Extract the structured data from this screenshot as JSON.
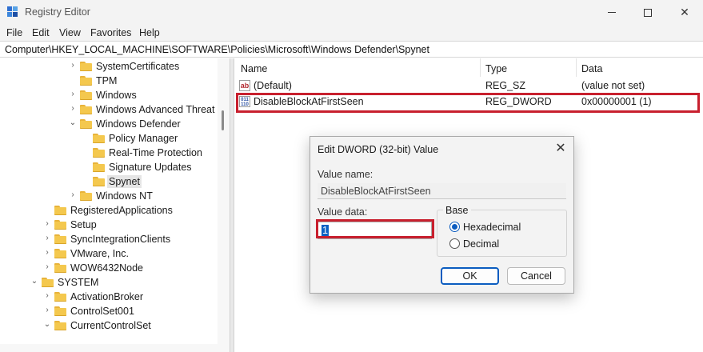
{
  "window": {
    "title": "Registry Editor"
  },
  "menu": [
    "File",
    "Edit",
    "View",
    "Favorites",
    "Help"
  ],
  "address": "Computer\\HKEY_LOCAL_MACHINE\\SOFTWARE\\Policies\\Microsoft\\Windows Defender\\Spynet",
  "tree": [
    {
      "label": "SystemCertificates",
      "chevron": ">"
    },
    {
      "label": "TPM",
      "chevron": ""
    },
    {
      "label": "Windows",
      "chevron": ">"
    },
    {
      "label": "Windows Advanced Threat P",
      "chevron": ">"
    },
    {
      "label": "Windows Defender",
      "chevron": "v"
    },
    {
      "label": "Policy Manager",
      "chevron": ""
    },
    {
      "label": "Real-Time Protection",
      "chevron": ""
    },
    {
      "label": "Signature Updates",
      "chevron": ""
    },
    {
      "label": "Spynet",
      "chevron": ""
    },
    {
      "label": "Windows NT",
      "chevron": ">"
    },
    {
      "label": "RegisteredApplications",
      "chevron": ""
    },
    {
      "label": "Setup",
      "chevron": ">"
    },
    {
      "label": "SyncIntegrationClients",
      "chevron": ">"
    },
    {
      "label": "VMware, Inc.",
      "chevron": ">"
    },
    {
      "label": "WOW6432Node",
      "chevron": ">"
    },
    {
      "label": "SYSTEM",
      "chevron": "v"
    },
    {
      "label": "ActivationBroker",
      "chevron": ">"
    },
    {
      "label": "ControlSet001",
      "chevron": ">"
    },
    {
      "label": "CurrentControlSet",
      "chevron": "v"
    }
  ],
  "list": {
    "columns": [
      "Name",
      "Type",
      "Data"
    ],
    "rows": [
      {
        "icon": "string-value-icon",
        "name": "(Default)",
        "type": "REG_SZ",
        "data": "(value not set)"
      },
      {
        "icon": "dword-value-icon",
        "name": "DisableBlockAtFirstSeen",
        "type": "REG_DWORD",
        "data": "0x00000001 (1)"
      }
    ]
  },
  "dialog": {
    "title": "Edit DWORD (32-bit) Value",
    "close": "✕",
    "value_name_label": "Value name:",
    "value_name": "DisableBlockAtFirstSeen",
    "value_data_label": "Value data:",
    "value_data": "1",
    "base_label": "Base",
    "base_options": [
      "Hexadecimal",
      "Decimal"
    ],
    "base_selected": "Hexadecimal",
    "ok": "OK",
    "cancel": "Cancel"
  },
  "colors": {
    "accent": "#0b5cc0",
    "highlight": "#c8202e",
    "folder": "#f4c84e"
  }
}
